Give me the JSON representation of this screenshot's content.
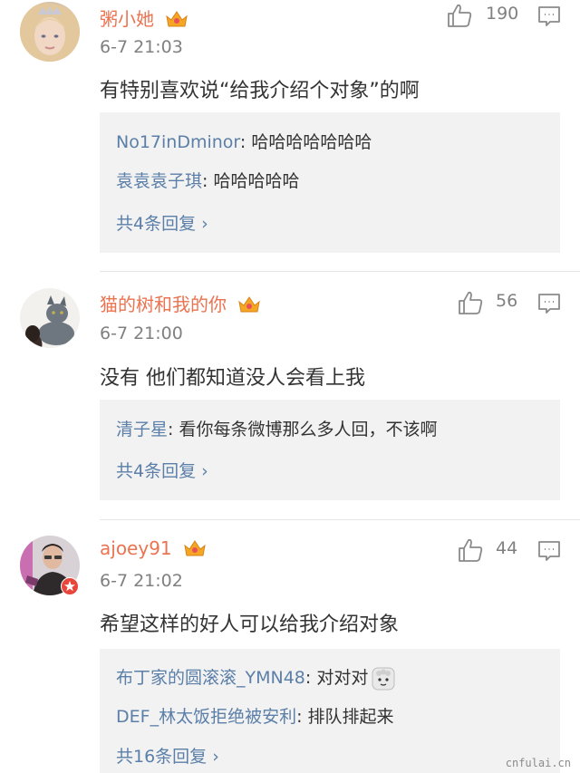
{
  "comments": [
    {
      "username": "粥小她",
      "time": "6-7 21:03",
      "likes": "190",
      "text": "有特别喜欢说“给我介绍个对象”的啊",
      "replies": [
        {
          "user": "No17inDminor",
          "text": ": 哈哈哈哈哈哈哈"
        },
        {
          "user": "袁袁袁子琪",
          "text": ": 哈哈哈哈哈"
        }
      ],
      "more": "共4条回复 ›"
    },
    {
      "username": "猫的树和我的你",
      "time": "6-7 21:00",
      "likes": "56",
      "text": "没有  他们都知道没人会看上我",
      "replies": [
        {
          "user": "清子星",
          "text": ": 看你每条微博那么多人回，不该啊"
        }
      ],
      "more": "共4条回复 ›"
    },
    {
      "username": "ajoey91",
      "time": "6-7 21:02",
      "likes": "44",
      "text": "希望这样的好人可以给我介绍对象",
      "replies": [
        {
          "user": "布丁家的圆滚滚_YMN48",
          "text": ": 对对对"
        },
        {
          "user": "DEF_林太饭拒绝被安利",
          "text": ": 排队排起来"
        }
      ],
      "more": "共16条回复 ›"
    }
  ],
  "watermark": "cnfulai.cn",
  "colors": {
    "username": "#eb7350",
    "reply_user": "#5b7fa8",
    "reply_bg": "#f2f2f2",
    "meta": "#808080"
  },
  "icons": {
    "like": "thumbs-up-icon",
    "reply": "comment-icon",
    "vip": "crown-vip-icon"
  }
}
